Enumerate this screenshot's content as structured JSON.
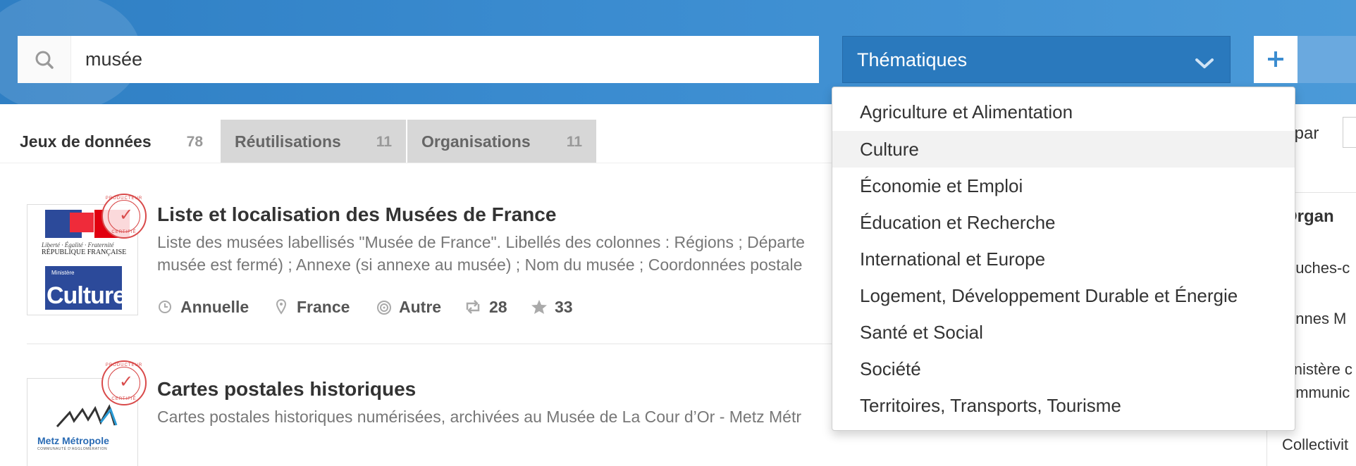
{
  "search": {
    "value": "musée"
  },
  "theme_select": {
    "label": "Thématiques"
  },
  "tabs": [
    {
      "label": "Jeux de données",
      "count": "78"
    },
    {
      "label": "Réutilisations",
      "count": "11"
    },
    {
      "label": "Organisations",
      "count": "11"
    }
  ],
  "results": [
    {
      "title": "Liste et localisation des Musées de France",
      "desc_line1": "Liste des musées labellisés \"Musée de France\". Libellés des colonnes : Régions ; Départe",
      "desc_line2": "musée est fermé) ; Annexe (si annexe au musée) ; Nom du musée ; Coordonnées postale",
      "frequency": "Annuelle",
      "spatial": "France",
      "granularity": "Autre",
      "reuses": "28",
      "stars": "33",
      "logo": {
        "devise": "Liberté · Égalité · Fraternité",
        "republique": "RÉPUBLIQUE FRANÇAISE",
        "ministere": "Ministère",
        "culture": "Culture"
      },
      "stamp": {
        "top": "PRODUCTEUR",
        "bottom": "CERTIFIÉ"
      }
    },
    {
      "title": "Cartes postales historiques",
      "desc_line1": "Cartes postales historiques numérisées, archivées au Musée de La Cour d’Or - Metz Métr",
      "logo": {
        "name": "Metz Métropole",
        "sub": "COMMUNAUTÉ D'AGGLOMÉRATION"
      },
      "stamp": {
        "top": "PRODUCTEUR",
        "bottom": "CERTIFIÉ"
      }
    }
  ],
  "sort": {
    "label": "r par"
  },
  "sidebar": {
    "header": "Organ",
    "items": [
      "ouches-c",
      "ennes M",
      "linistère c",
      "ommunic",
      "Collectivit"
    ]
  },
  "dropdown": {
    "items": [
      "Agriculture et Alimentation",
      "Culture",
      "Économie et Emploi",
      "Éducation et Recherche",
      "International et Europe",
      "Logement, Développement Durable et Énergie",
      "Santé et Social",
      "Société",
      "Territoires, Transports, Tourisme"
    ],
    "hovered_index": 1
  },
  "colors": {
    "hero": "#3b8cd0",
    "select": "#2a79bd",
    "accent": "#3b8cd0",
    "stamp": "#d94a4a"
  }
}
